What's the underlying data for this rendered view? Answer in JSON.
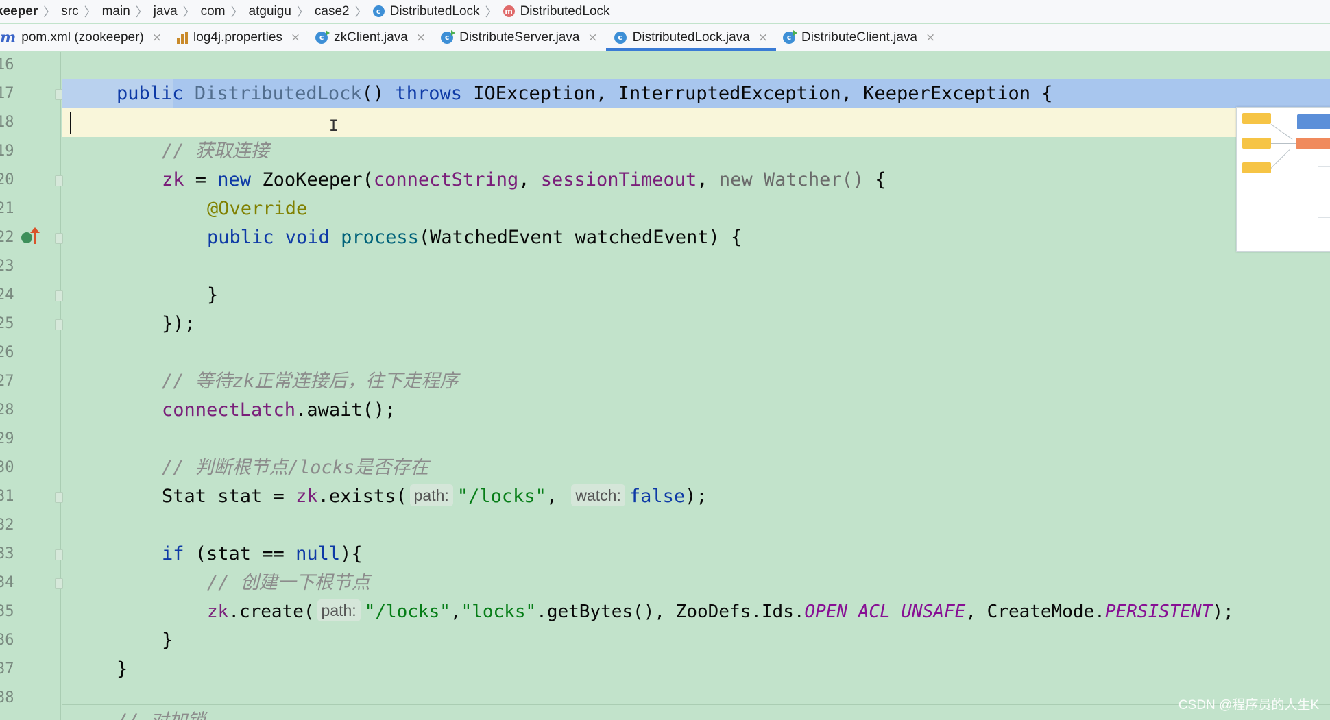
{
  "breadcrumb": {
    "items": [
      {
        "label": "keeper",
        "icon": ""
      },
      {
        "label": "src",
        "icon": ""
      },
      {
        "label": "main",
        "icon": ""
      },
      {
        "label": "java",
        "icon": ""
      },
      {
        "label": "com",
        "icon": ""
      },
      {
        "label": "atguigu",
        "icon": ""
      },
      {
        "label": "case2",
        "icon": ""
      },
      {
        "label": "DistributedLock",
        "icon": "class-icon",
        "icon_glyph": "c"
      },
      {
        "label": "DistributedLock",
        "icon": "method-icon",
        "icon_glyph": "m"
      }
    ],
    "separator": "〉"
  },
  "tabs": [
    {
      "label": "pom.xml (zookeeper)",
      "icon": "maven-icon",
      "icon_glyph": "m",
      "close": "×",
      "active": false
    },
    {
      "label": "log4j.properties",
      "icon": "properties-icon",
      "close": "×",
      "active": false
    },
    {
      "label": "zkClient.java",
      "icon": "class-icon",
      "icon_glyph": "c",
      "close": "×",
      "active": false
    },
    {
      "label": "DistributeServer.java",
      "icon": "runnable-class-icon",
      "icon_glyph": "c",
      "close": "×",
      "active": false
    },
    {
      "label": "DistributedLock.java",
      "icon": "class-icon",
      "icon_glyph": "c",
      "close": "×",
      "active": true
    },
    {
      "label": "DistributeClient.java",
      "icon": "runnable-class-icon",
      "icon_glyph": "c",
      "close": "×",
      "active": false
    }
  ],
  "editor": {
    "line_numbers": [
      "16",
      "17",
      "18",
      "19",
      "20",
      "21",
      "22",
      "23",
      "24",
      "25",
      "26",
      "27",
      "28",
      "29",
      "30",
      "31",
      "32",
      "33",
      "34",
      "35",
      "36",
      "37",
      "38"
    ],
    "lines": {
      "l17": {
        "kw1": "public",
        "ctor": "DistributedLock",
        "p1": "() ",
        "kw2": "throws",
        "rest": " IOException, InterruptedException, KeeperException {"
      },
      "l19": {
        "comment": "// 获取连接"
      },
      "l20": {
        "fld": "zk",
        "eq": " = ",
        "kw": "new",
        "cls": " ZooKeeper(",
        "a1": "connectString",
        "c1": ", ",
        "a2": "sessionTimeout",
        "c2": ", ",
        "gray": "new Watcher()",
        "end": " {"
      },
      "l21": {
        "ann": "@Override"
      },
      "l22": {
        "kw": "public void",
        "sp": " ",
        "mth": "process",
        "rest": "(WatchedEvent watchedEvent) {"
      },
      "l24": {
        "text": "}"
      },
      "l25": {
        "text": "});"
      },
      "l27": {
        "comment": "// 等待zk正常连接后，往下走程序"
      },
      "l28": {
        "fld": "connectLatch",
        "rest": ".await();"
      },
      "l30": {
        "comment": "// 判断根节点/locks是否存在"
      },
      "l31": {
        "p1": "Stat stat = ",
        "fld": "zk",
        "p2": ".exists(",
        "hint1": "path:",
        "str1": "\"/locks\"",
        "p3": ", ",
        "hint2": "watch:",
        "kw": "false",
        "p4": ");"
      },
      "l33": {
        "kw1": "if",
        "p1": " (stat == ",
        "kw2": "null",
        "p2": "){"
      },
      "l34": {
        "comment": "// 创建一下根节点"
      },
      "l35": {
        "fld": "zk",
        "p1": ".create(",
        "hint": "path:",
        "str1": "\"/locks\"",
        "p2": ",",
        "str2": "\"locks\"",
        "p3": ".getBytes(), ZooDefs.Ids.",
        "c1": "OPEN_ACL_UNSAFE",
        "p4": ", CreateMode.",
        "c2": "PERSISTENT",
        "p5": ");"
      },
      "l36": {
        "text": "}"
      },
      "l37": {
        "text": "}"
      },
      "l39": {
        "comment": "// 对加锁"
      }
    }
  },
  "watermark": "CSDN @程序员的人生K",
  "colors": {
    "editor_bg": "#c2e3cb",
    "selection": "#a8c6ee",
    "caret_line": "#f9f6da",
    "active_tab_underline": "#3a7bd5",
    "keyword": "#0e3aa6",
    "string": "#067d17",
    "comment": "#8c8c8c"
  }
}
